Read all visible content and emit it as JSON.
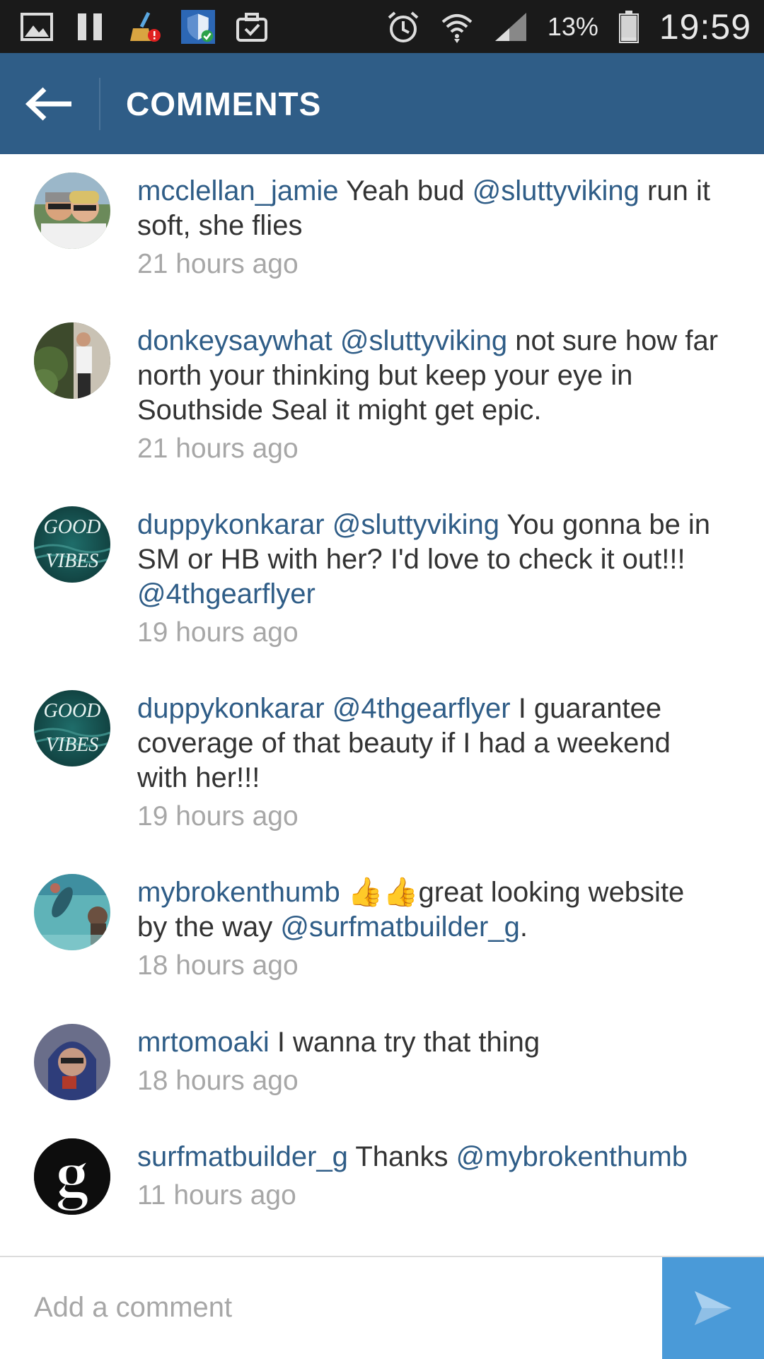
{
  "status_bar": {
    "battery_percent": "13%",
    "time": "19:59",
    "icons": [
      "gallery-icon",
      "pause-icon",
      "cleaner-icon",
      "shield-icon",
      "briefcase-icon",
      "alarm-icon",
      "wifi-icon",
      "signal-icon",
      "battery-icon"
    ]
  },
  "header": {
    "title": "COMMENTS"
  },
  "comments": [
    {
      "username": "mcclellan_jamie",
      "text_parts": [
        " Yeah bud ",
        "@sluttyviking",
        " run it soft, she flies"
      ],
      "timestamp": "21 hours ago"
    },
    {
      "username": "donkeysaywhat",
      "text_parts": [
        " ",
        "@sluttyviking",
        " not sure how far north your thinking but keep your eye in Southside Seal it might get epic."
      ],
      "timestamp": "21 hours ago"
    },
    {
      "username": "duppykonkarar",
      "text_parts": [
        " ",
        "@sluttyviking",
        " You gonna be in SM or HB with her? I'd love to check it out!!! ",
        "@4thgearflyer"
      ],
      "timestamp": "19 hours ago"
    },
    {
      "username": "duppykonkarar",
      "text_parts": [
        " ",
        "@4thgearflyer",
        " I guarantee coverage of that beauty if I had a weekend with her!!!"
      ],
      "timestamp": "19 hours ago"
    },
    {
      "username": "mybrokenthumb",
      "text_parts": [
        " 👍👍great looking website by the way ",
        "@surfmatbuilder_g",
        "."
      ],
      "timestamp": "18 hours ago"
    },
    {
      "username": "mrtomoaki",
      "text_parts": [
        " I wanna try that thing"
      ],
      "timestamp": "18 hours ago"
    },
    {
      "username": "surfmatbuilder_g",
      "text_parts": [
        " Thanks ",
        "@mybrokenthumb"
      ],
      "timestamp": "11 hours ago"
    }
  ],
  "avatar_text": {
    "good_vibes_top": "GOOD",
    "good_vibes_bottom": "VIBES",
    "g_logo": "g"
  },
  "composer": {
    "placeholder": "Add a comment"
  },
  "colors": {
    "header": "#2f5d87",
    "link": "#2f5d87",
    "timestamp": "#a7a7a7",
    "send_button": "#4a9ad8"
  }
}
